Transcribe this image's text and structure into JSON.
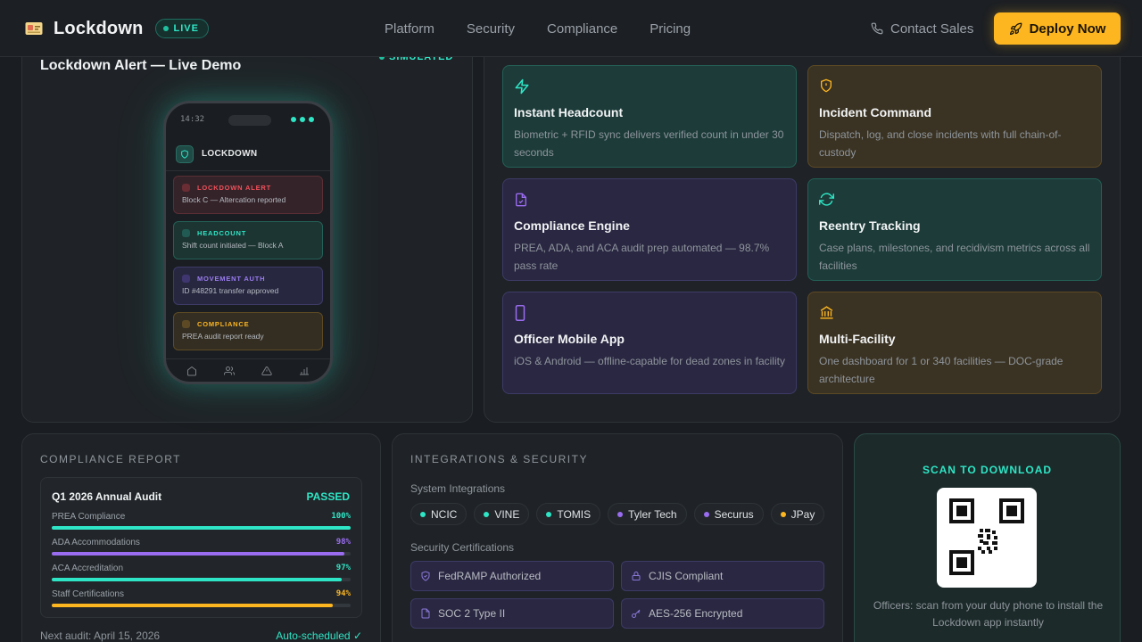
{
  "nav": {
    "brand": "Lockdown",
    "live_badge": "LIVE",
    "links": [
      "Platform",
      "Security",
      "Compliance",
      "Pricing"
    ],
    "contact": "Contact Sales",
    "deploy": "Deploy Now"
  },
  "demo": {
    "title": "Lockdown Alert — Live Demo",
    "badge": "SIMULATED",
    "phone": {
      "time": "14:32",
      "header": "LOCKDOWN",
      "cards": [
        {
          "tag": "LOCKDOWN ALERT",
          "msg": "Block C — Altercation reported"
        },
        {
          "tag": "HEADCOUNT",
          "msg": "Shift count initiated — Block A"
        },
        {
          "tag": "MOVEMENT AUTH",
          "msg": "ID #48291 transfer approved"
        },
        {
          "tag": "COMPLIANCE",
          "msg": "PREA audit report ready"
        }
      ]
    }
  },
  "features": [
    {
      "title": "Instant Headcount",
      "desc": "Biometric + RFID sync delivers verified count in under 30 seconds",
      "icon": "lightning-icon"
    },
    {
      "title": "Incident Command",
      "desc": "Dispatch, log, and close incidents with full chain-of-custody",
      "icon": "shield-alert-icon"
    },
    {
      "title": "Compliance Engine",
      "desc": "PREA, ADA, and ACA audit prep automated — 98.7% pass rate",
      "icon": "document-icon"
    },
    {
      "title": "Reentry Tracking",
      "desc": "Case plans, milestones, and recidivism metrics across all facilities",
      "icon": "refresh-icon"
    },
    {
      "title": "Officer Mobile App",
      "desc": "iOS & Android — offline-capable for dead zones in facility",
      "icon": "phone-icon"
    },
    {
      "title": "Multi-Facility",
      "desc": "One dashboard for 1 or 340 facilities — DOC-grade architecture",
      "icon": "building-icon"
    }
  ],
  "compliance": {
    "label": "COMPLIANCE REPORT",
    "audit_title": "Q1 2026 Annual Audit",
    "status": "PASSED",
    "metrics": [
      {
        "label": "PREA Compliance",
        "display": "100%",
        "value": 100,
        "color": "#2ee6c6"
      },
      {
        "label": "ADA Accommodations",
        "display": "98%",
        "value": 98,
        "color": "#9a6cf0"
      },
      {
        "label": "ACA Accreditation",
        "display": "97%",
        "value": 97,
        "color": "#2ee6c6"
      },
      {
        "label": "Staff Certifications",
        "display": "94%",
        "value": 94,
        "color": "#fdb620"
      }
    ],
    "next_audit": "Next audit: April 15, 2026",
    "auto": "Auto-scheduled ✓"
  },
  "integrations": {
    "label": "INTEGRATIONS & SECURITY",
    "systems_label": "System Integrations",
    "systems": [
      {
        "name": "NCIC",
        "color": "#2ee6c6"
      },
      {
        "name": "VINE",
        "color": "#2ee6c6"
      },
      {
        "name": "TOMIS",
        "color": "#2ee6c6"
      },
      {
        "name": "Tyler Tech",
        "color": "#9a6cf0"
      },
      {
        "name": "Securus",
        "color": "#9a6cf0"
      },
      {
        "name": "JPay",
        "color": "#fdb620"
      }
    ],
    "certs_label": "Security Certifications",
    "certs": [
      "FedRAMP Authorized",
      "CJIS Compliant",
      "SOC 2 Type II",
      "AES-256 Encrypted"
    ]
  },
  "qr": {
    "title": "SCAN TO DOWNLOAD",
    "note": "Officers: scan from your duty phone to install the Lockdown app instantly"
  }
}
